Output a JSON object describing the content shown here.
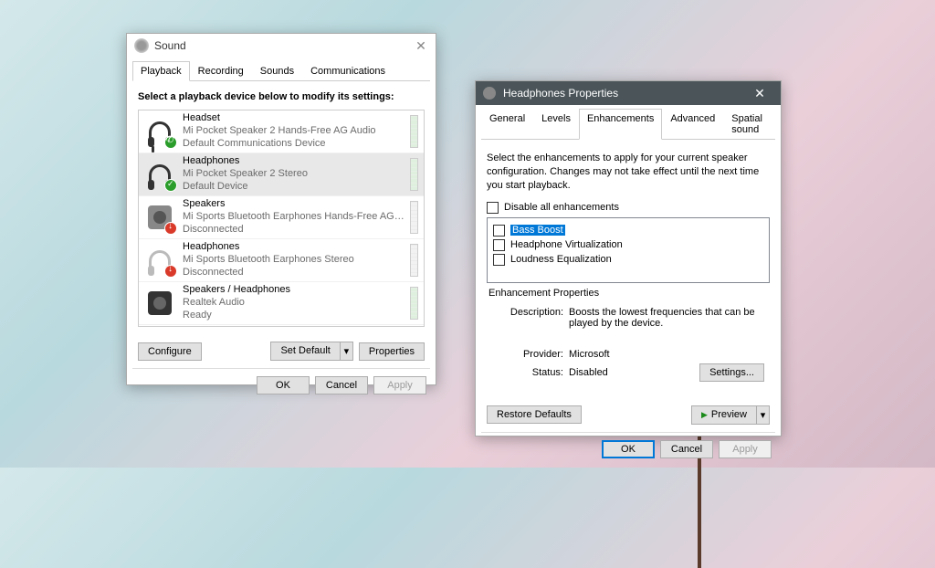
{
  "sound_window": {
    "title": "Sound",
    "tabs": [
      "Playback",
      "Recording",
      "Sounds",
      "Communications"
    ],
    "active_tab": 0,
    "instruction": "Select a playback device below to modify its settings:",
    "devices": [
      {
        "name": "Headset",
        "desc": "Mi Pocket Speaker 2 Hands-Free AG Audio",
        "status": "Default Communications Device",
        "icon": "headset",
        "badge": "green-phone",
        "meter": true,
        "selected": false
      },
      {
        "name": "Headphones",
        "desc": "Mi Pocket Speaker 2 Stereo",
        "status": "Default Device",
        "icon": "headphones",
        "badge": "green",
        "meter": true,
        "selected": true
      },
      {
        "name": "Speakers",
        "desc": "Mi Sports Bluetooth Earphones Hands-Free AG A...",
        "status": "Disconnected",
        "icon": "speaker",
        "badge": "red",
        "meter": false,
        "selected": false
      },
      {
        "name": "Headphones",
        "desc": "Mi Sports Bluetooth Earphones Stereo",
        "status": "Disconnected",
        "icon": "headphones-grey",
        "badge": "red",
        "meter": false,
        "selected": false
      },
      {
        "name": "Speakers / Headphones",
        "desc": "Realtek Audio",
        "status": "Ready",
        "icon": "speaker-dark",
        "badge": "none",
        "meter": true,
        "selected": false
      }
    ],
    "buttons": {
      "configure": "Configure",
      "set_default": "Set Default",
      "properties": "Properties",
      "ok": "OK",
      "cancel": "Cancel",
      "apply": "Apply"
    }
  },
  "props_window": {
    "title": "Headphones Properties",
    "tabs": [
      "General",
      "Levels",
      "Enhancements",
      "Advanced",
      "Spatial sound"
    ],
    "active_tab": 2,
    "instruction": "Select the enhancements to apply for your current speaker configuration. Changes may not take effect until the next time you start playback.",
    "disable_all": "Disable all enhancements",
    "enhancements": [
      {
        "label": "Bass Boost",
        "selected": true
      },
      {
        "label": "Headphone Virtualization",
        "selected": false
      },
      {
        "label": "Loudness Equalization",
        "selected": false
      }
    ],
    "properties": {
      "legend": "Enhancement Properties",
      "description_label": "Description:",
      "description": "Boosts the lowest frequencies that can be played by the device.",
      "provider_label": "Provider:",
      "provider": "Microsoft",
      "status_label": "Status:",
      "status": "Disabled"
    },
    "buttons": {
      "settings": "Settings...",
      "restore": "Restore Defaults",
      "preview": "Preview",
      "ok": "OK",
      "cancel": "Cancel",
      "apply": "Apply"
    }
  }
}
